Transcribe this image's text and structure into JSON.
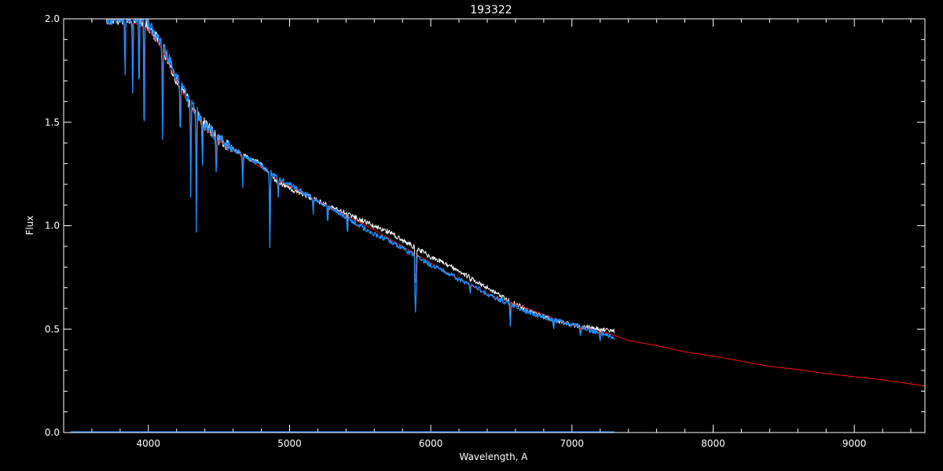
{
  "chart_data": {
    "type": "line",
    "title": "193322",
    "xlabel": "Wavelength, A",
    "ylabel": "Flux",
    "xlim": [
      3400,
      9500
    ],
    "ylim": [
      0.0,
      2.0
    ],
    "x_ticks": [
      4000,
      5000,
      6000,
      7000,
      8000,
      9000
    ],
    "x_tick_labels": [
      "4000",
      "5000",
      "6000",
      "7000",
      "8000",
      "9000"
    ],
    "y_ticks": [
      0.0,
      0.5,
      1.0,
      1.5,
      2.0
    ],
    "y_tick_labels": [
      "0.0",
      "0.5",
      "1.0",
      "1.5",
      "2.0"
    ],
    "grid": false,
    "colors": {
      "background": "#000000",
      "axes": "#ffffff",
      "observed": "#ffffff",
      "model": "#ff1010",
      "calibrated": "#1e90ff",
      "error": "#1e90ff"
    },
    "series": [
      {
        "color_key": "observed",
        "x": [
          3700,
          3800,
          3900,
          4000,
          4100,
          4200,
          4300,
          4400,
          4500,
          4600,
          4700,
          4800,
          4900,
          5000,
          5100,
          5200,
          5300,
          5400,
          5500,
          5600,
          5700,
          5800,
          5900,
          6000,
          6100,
          6200,
          6300,
          6400,
          6500,
          6600,
          6700,
          6800,
          6900,
          7000,
          7100,
          7200,
          7300
        ],
        "y": [
          2.0,
          2.0,
          2.0,
          1.97,
          1.86,
          1.7,
          1.58,
          1.49,
          1.42,
          1.37,
          1.33,
          1.3,
          1.22,
          1.18,
          1.15,
          1.12,
          1.09,
          1.06,
          1.03,
          1.0,
          0.97,
          0.93,
          0.89,
          0.85,
          0.82,
          0.78,
          0.74,
          0.7,
          0.66,
          0.62,
          0.59,
          0.56,
          0.54,
          0.52,
          0.51,
          0.5,
          0.49
        ]
      },
      {
        "color_key": "model",
        "x": [
          3700,
          3800,
          3900,
          4000,
          4100,
          4200,
          4300,
          4400,
          4500,
          4600,
          4700,
          4800,
          4900,
          5000,
          5200,
          5400,
          5600,
          5800,
          6000,
          6200,
          6400,
          6600,
          6800,
          7000,
          7200,
          7300,
          7400,
          7600,
          7800,
          8000,
          8200,
          8400,
          8600,
          8800,
          9000,
          9200,
          9400,
          9500
        ],
        "y": [
          2.0,
          2.0,
          1.98,
          1.95,
          1.85,
          1.7,
          1.57,
          1.47,
          1.41,
          1.36,
          1.33,
          1.28,
          1.23,
          1.19,
          1.12,
          1.05,
          0.98,
          0.9,
          0.82,
          0.74,
          0.67,
          0.62,
          0.57,
          0.52,
          0.49,
          0.47,
          0.445,
          0.42,
          0.39,
          0.37,
          0.345,
          0.32,
          0.305,
          0.285,
          0.27,
          0.255,
          0.235,
          0.225
        ]
      },
      {
        "color_key": "calibrated",
        "x": [
          3700,
          3800,
          3900,
          4000,
          4100,
          4200,
          4300,
          4400,
          4500,
          4600,
          4700,
          4800,
          4900,
          5000,
          5100,
          5200,
          5300,
          5400,
          5500,
          5600,
          5700,
          5800,
          5900,
          6000,
          6100,
          6200,
          6300,
          6400,
          6500,
          6600,
          6700,
          6800,
          6900,
          7000,
          7100,
          7200,
          7300
        ],
        "y": [
          2.0,
          2.0,
          2.0,
          1.98,
          1.87,
          1.72,
          1.59,
          1.49,
          1.42,
          1.37,
          1.33,
          1.29,
          1.24,
          1.2,
          1.16,
          1.12,
          1.08,
          1.04,
          1.0,
          0.96,
          0.93,
          0.89,
          0.85,
          0.81,
          0.78,
          0.74,
          0.71,
          0.67,
          0.64,
          0.61,
          0.58,
          0.56,
          0.54,
          0.52,
          0.5,
          0.48,
          0.46
        ]
      },
      {
        "color_key": "error",
        "x": [
          3450,
          7300
        ],
        "y": [
          0.0,
          0.0
        ]
      }
    ],
    "absorption_lines": [
      {
        "x": 3835,
        "depth": 0.3
      },
      {
        "x": 3889,
        "depth": 0.45
      },
      {
        "x": 3934,
        "depth": 0.45
      },
      {
        "x": 3970,
        "depth": 0.7
      },
      {
        "x": 4101,
        "depth": 0.55
      },
      {
        "x": 4226,
        "depth": 0.3
      },
      {
        "x": 4300,
        "depth": 0.45
      },
      {
        "x": 4340,
        "depth": 0.58
      },
      {
        "x": 4383,
        "depth": 0.25
      },
      {
        "x": 4481,
        "depth": 0.22
      },
      {
        "x": 4668,
        "depth": 0.15
      },
      {
        "x": 4861,
        "depth": 0.43
      },
      {
        "x": 4920,
        "depth": 0.1
      },
      {
        "x": 5167,
        "depth": 0.08
      },
      {
        "x": 5270,
        "depth": 0.08
      },
      {
        "x": 5410,
        "depth": 0.1
      },
      {
        "x": 5890,
        "depth": 0.3
      },
      {
        "x": 5896,
        "depth": 0.2
      },
      {
        "x": 6280,
        "depth": 0.04
      },
      {
        "x": 6563,
        "depth": 0.14
      },
      {
        "x": 6870,
        "depth": 0.06
      },
      {
        "x": 7060,
        "depth": 0.05
      },
      {
        "x": 7200,
        "depth": 0.04
      }
    ]
  }
}
